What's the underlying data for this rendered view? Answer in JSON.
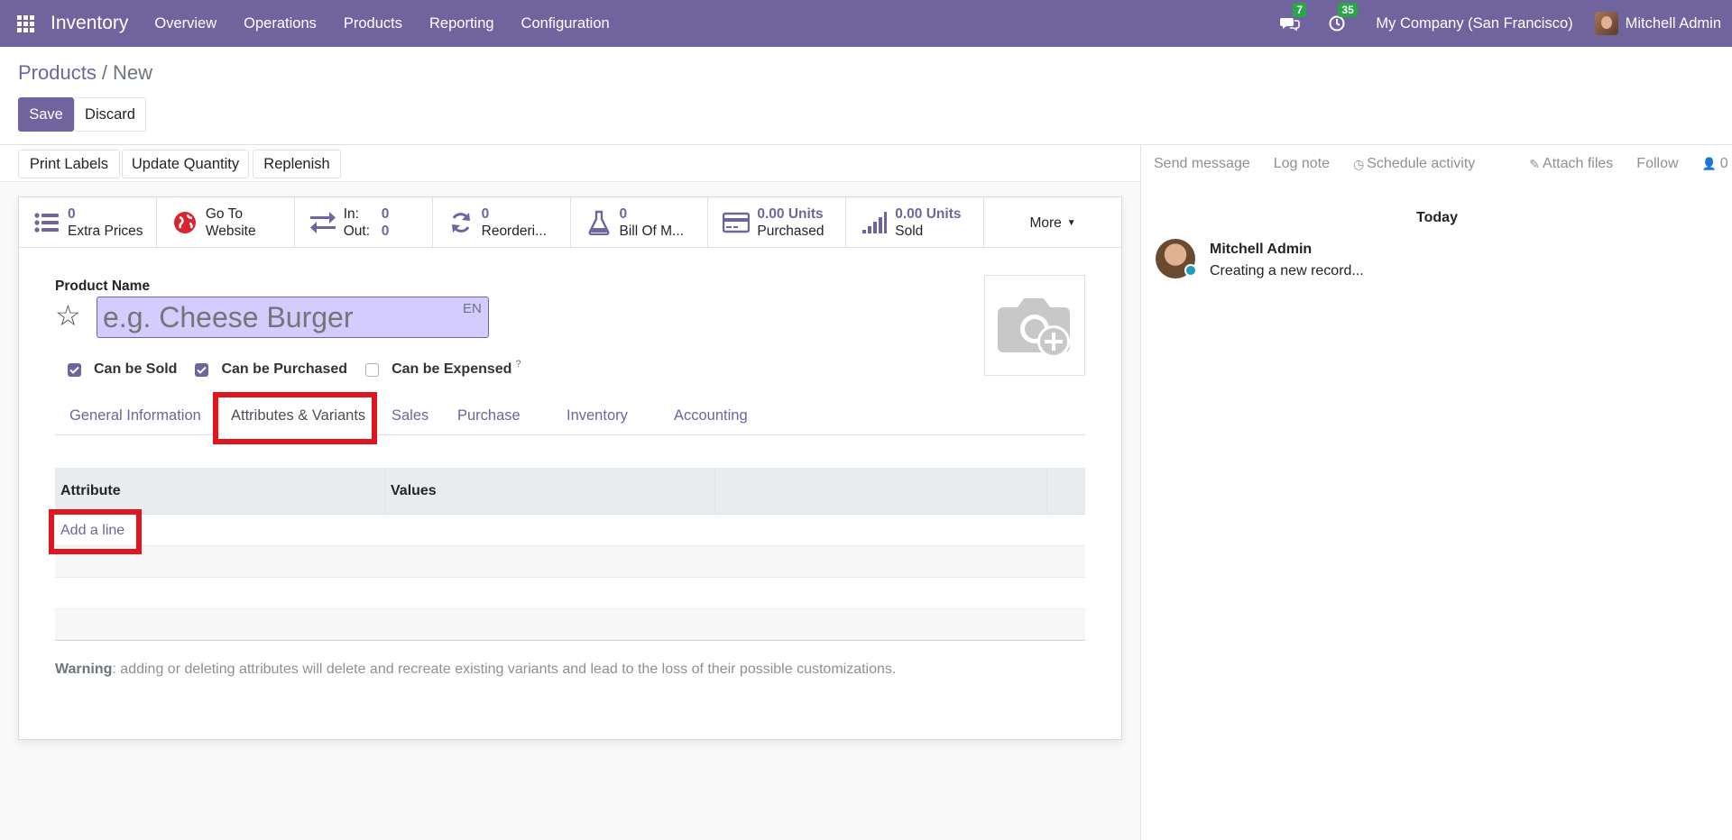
{
  "navbar": {
    "app_name": "Inventory",
    "menu": [
      "Overview",
      "Operations",
      "Products",
      "Reporting",
      "Configuration"
    ],
    "messages_count": "7",
    "activities_count": "35",
    "company": "My Company (San Francisco)",
    "user": "Mitchell Admin",
    "color": "#71639e"
  },
  "breadcrumb": {
    "parent": "Products",
    "separator": "/",
    "current": "New"
  },
  "actions": {
    "save": "Save",
    "discard": "Discard"
  },
  "statusbar": {
    "buttons": [
      "Print Labels",
      "Update Quantity",
      "Replenish"
    ]
  },
  "smart_buttons": {
    "extra_prices": {
      "value": "0",
      "label": "Extra Prices"
    },
    "website": {
      "line1": "Go To",
      "line2": "Website"
    },
    "in_out": {
      "in_label": "In:",
      "in_value": "0",
      "out_label": "Out:",
      "out_value": "0"
    },
    "reordering": {
      "value": "0",
      "label": "Reorderi..."
    },
    "bom": {
      "value": "0",
      "label": "Bill Of M..."
    },
    "purchased": {
      "value": "0.00 Units",
      "label": "Purchased"
    },
    "sold": {
      "value": "0.00 Units",
      "label": "Sold"
    },
    "more": "More"
  },
  "form": {
    "product_name_label": "Product Name",
    "product_name_placeholder": "e.g. Cheese Burger",
    "lang": "EN",
    "checkboxes": [
      {
        "label": "Can be Sold",
        "checked": true
      },
      {
        "label": "Can be Purchased",
        "checked": true
      },
      {
        "label": "Can be Expensed",
        "checked": false,
        "help": "?"
      }
    ],
    "tabs": [
      "General Information",
      "Attributes & Variants",
      "Sales",
      "Purchase",
      "Inventory",
      "Accounting"
    ],
    "active_tab": "Attributes & Variants",
    "table": {
      "columns": [
        "Attribute",
        "Values"
      ],
      "add_line": "Add a line"
    },
    "warning_title": "Warning",
    "warning_text": ": adding or deleting attributes will delete and recreate existing variants and lead to the loss of their possible customizations."
  },
  "chatter": {
    "send_message": "Send message",
    "log_note": "Log note",
    "schedule_activity": "Schedule activity",
    "attach_files": "Attach files",
    "follow": "Follow",
    "followers_count": "0",
    "today": "Today",
    "message": {
      "author": "Mitchell Admin",
      "body": "Creating a new record..."
    }
  }
}
